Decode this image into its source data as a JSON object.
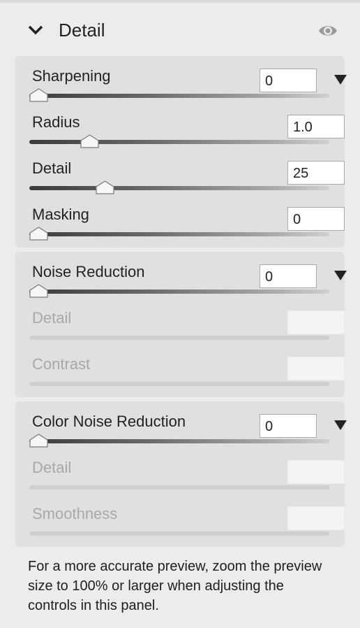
{
  "header": {
    "title": "Detail",
    "collapse_icon": "chevron-down-icon",
    "visibility_icon": "eye-icon"
  },
  "sharpening": {
    "title": "Sharpening",
    "value": "0",
    "amount": 0,
    "radius": {
      "label": "Radius",
      "value": "1.0",
      "fraction": 0.2
    },
    "detail": {
      "label": "Detail",
      "value": "25",
      "fraction": 0.25
    },
    "masking": {
      "label": "Masking",
      "value": "0",
      "fraction": 0
    }
  },
  "noise_reduction": {
    "title": "Noise Reduction",
    "value": "0",
    "amount": 0,
    "detail": {
      "label": "Detail",
      "value": ""
    },
    "contrast": {
      "label": "Contrast",
      "value": ""
    }
  },
  "color_noise_reduction": {
    "title": "Color Noise Reduction",
    "value": "0",
    "amount": 0,
    "detail": {
      "label": "Detail",
      "value": ""
    },
    "smoothness": {
      "label": "Smoothness",
      "value": ""
    }
  },
  "note": "For a more accurate preview, zoom the preview size to 100% or larger when adjusting the controls in this panel.",
  "colors": {
    "panel": "#ececec",
    "group": "#e0e0e0",
    "disabled_text": "#a8a8a8"
  }
}
